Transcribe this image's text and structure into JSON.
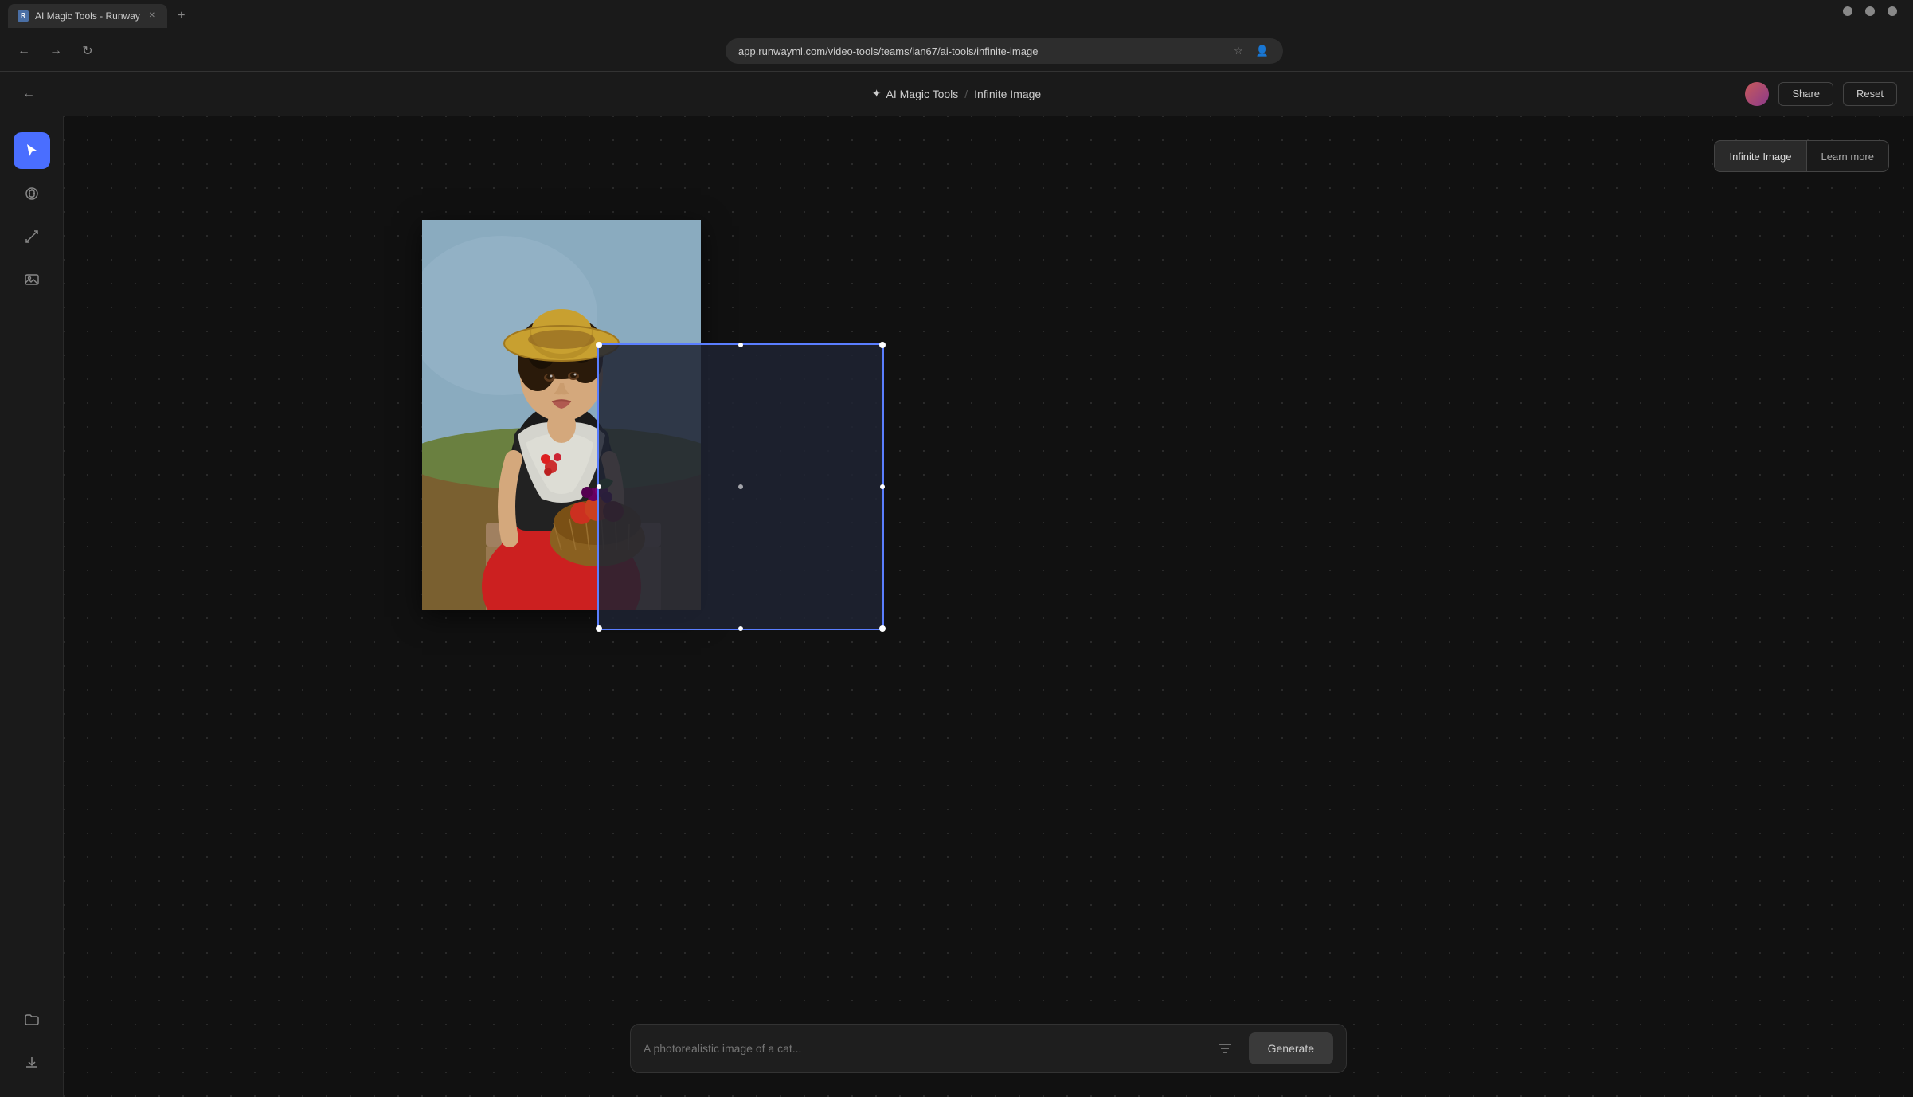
{
  "browser": {
    "tab_title": "AI Magic Tools - Runway",
    "tab_favicon": "R",
    "url": "app.runwayml.com/video-tools/teams/ian67/ai-tools/infinite-image",
    "new_tab_label": "+"
  },
  "header": {
    "back_arrow": "←",
    "breadcrumb_tool": "AI Magic Tools",
    "breadcrumb_separator": "/",
    "page_title": "Infinite Image",
    "magic_wand": "✦",
    "share_label": "Share",
    "reset_label": "Reset"
  },
  "sidebar": {
    "tools": [
      {
        "name": "select",
        "icon": "↖",
        "active": true,
        "label": "Select Tool"
      },
      {
        "name": "hand",
        "icon": "✋",
        "active": false,
        "label": "Pan Tool"
      },
      {
        "name": "expand",
        "icon": "⤢",
        "active": false,
        "label": "Expand Tool"
      },
      {
        "name": "image",
        "icon": "🖼",
        "active": false,
        "label": "Image Tool"
      }
    ],
    "bottom_tools": [
      {
        "name": "folder",
        "icon": "📁",
        "label": "Folder"
      },
      {
        "name": "download",
        "icon": "⬇",
        "label": "Download"
      }
    ]
  },
  "info_panel": {
    "active_label": "Infinite Image",
    "learn_more_label": "Learn more"
  },
  "canvas": {
    "selection_box": {
      "visible": true
    }
  },
  "bottom_bar": {
    "prompt_placeholder": "A photorealistic image of a cat...",
    "prompt_value": "",
    "settings_icon": "⚙",
    "generate_label": "Generate"
  }
}
